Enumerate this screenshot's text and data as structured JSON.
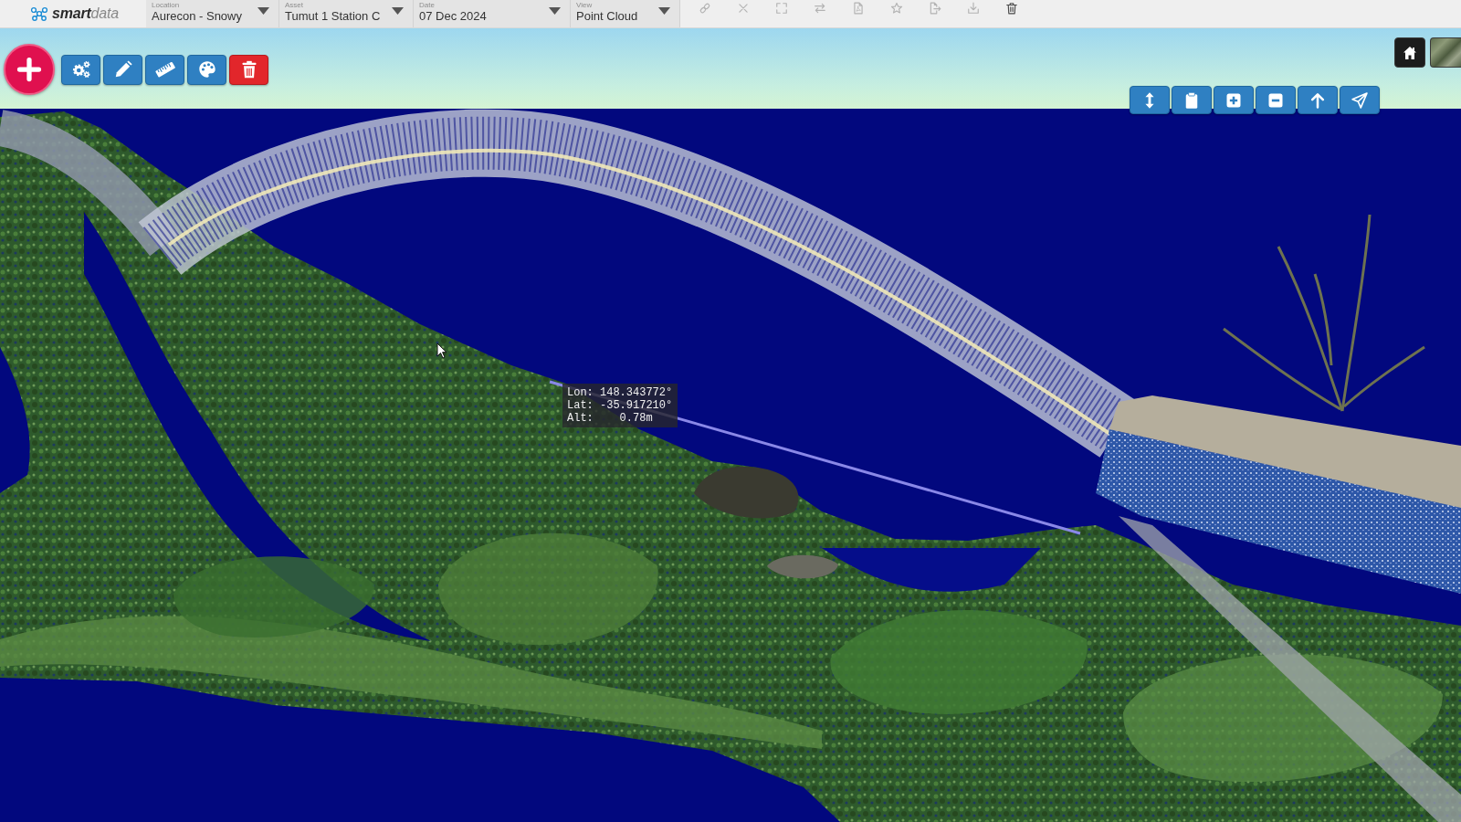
{
  "app": {
    "logo": "**smart**data"
  },
  "filters": [
    {
      "label": "Location",
      "value": "Aurecon - Snowy"
    },
    {
      "label": "Asset",
      "value": "Tumut 1 Station C"
    },
    {
      "label": "Date",
      "value": "07 Dec 2024"
    },
    {
      "label": "View",
      "value": "Point Cloud"
    }
  ],
  "actions": [
    {
      "kind": "link",
      "disabled": true
    },
    {
      "kind": "close",
      "disabled": true
    },
    {
      "kind": "fullscreen",
      "disabled": true
    },
    {
      "kind": "swap",
      "disabled": true
    },
    {
      "kind": "pdf",
      "disabled": true
    },
    {
      "kind": "star",
      "disabled": true
    },
    {
      "kind": "export",
      "disabled": true
    },
    {
      "kind": "download",
      "disabled": true
    },
    {
      "kind": "trash",
      "disabled": false
    }
  ],
  "tools": [
    {
      "kind": "add"
    },
    {
      "kind": "settings"
    },
    {
      "kind": "edit"
    },
    {
      "kind": "measure"
    },
    {
      "kind": "palette"
    },
    {
      "kind": "delete"
    }
  ],
  "view_tools": [
    {
      "kind": "height"
    },
    {
      "kind": "clipboard"
    },
    {
      "kind": "zoom_in"
    },
    {
      "kind": "zoom_out"
    },
    {
      "kind": "up"
    },
    {
      "kind": "send"
    }
  ],
  "map_controls": [
    {
      "kind": "home"
    },
    {
      "kind": "basemap"
    }
  ],
  "measurement": {
    "lines": [
      "Lon: 148.343772°",
      "Lat: -35.917210°",
      "Alt:    0.78m"
    ]
  }
}
